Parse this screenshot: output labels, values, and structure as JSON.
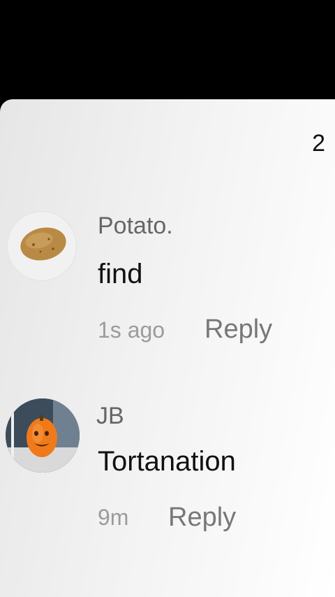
{
  "header": {
    "comment_count": "2"
  },
  "comments": [
    {
      "username": "Potato.",
      "text": "find",
      "time": "1s ago",
      "reply_label": "Reply",
      "avatar_icon": "potato-avatar"
    },
    {
      "username": "JB",
      "text": "Tortanation",
      "time": "9m",
      "reply_label": "Reply",
      "avatar_icon": "pumpkin-avatar"
    }
  ]
}
